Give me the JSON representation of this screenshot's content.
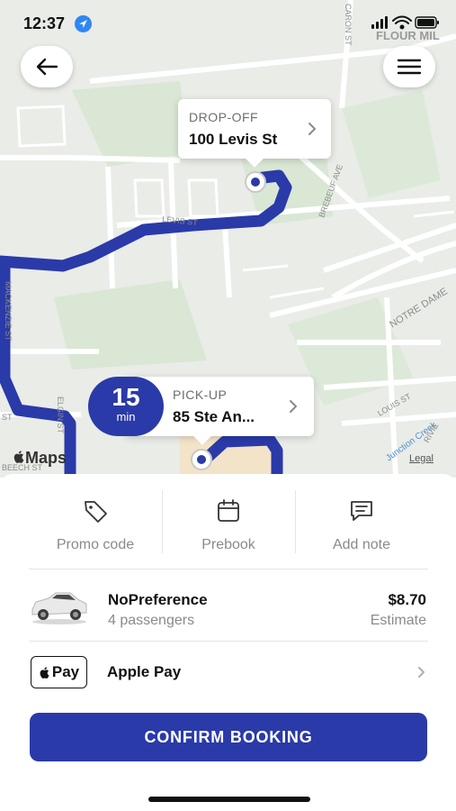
{
  "status_bar": {
    "time": "12:37"
  },
  "map": {
    "street_labels": [
      "FLOUR MIL",
      "CARON ST",
      "BREBEUF AVE",
      "LEVIS ST",
      "MACKENZIE ST",
      "NOTRE DAME",
      "LOUIS ST",
      "Junction Creek",
      "ELGIN ST",
      "RIVIE",
      "BEECH ST",
      "ST"
    ],
    "maps_logo": "Maps",
    "legal": "Legal",
    "route_color": "#2a3aa8"
  },
  "dropoff": {
    "label": "DROP-OFF",
    "address": "100 Levis St"
  },
  "pickup": {
    "label": "PICK-UP",
    "address": "85 Ste An..."
  },
  "eta": {
    "value": "15",
    "unit": "min"
  },
  "actions": [
    {
      "label": "Promo code",
      "icon": "tag-icon"
    },
    {
      "label": "Prebook",
      "icon": "calendar-icon"
    },
    {
      "label": "Add note",
      "icon": "message-icon"
    }
  ],
  "vehicle": {
    "name": "NoPreference",
    "passengers": "4 passengers",
    "price": "$8.70",
    "price_note": "Estimate"
  },
  "payment": {
    "badge": "Pay",
    "method": "Apple Pay"
  },
  "confirm_label": "CONFIRM BOOKING",
  "colors": {
    "accent": "#2a3aa8",
    "map_bg": "#eaeee8",
    "park": "#d6e6d2"
  }
}
